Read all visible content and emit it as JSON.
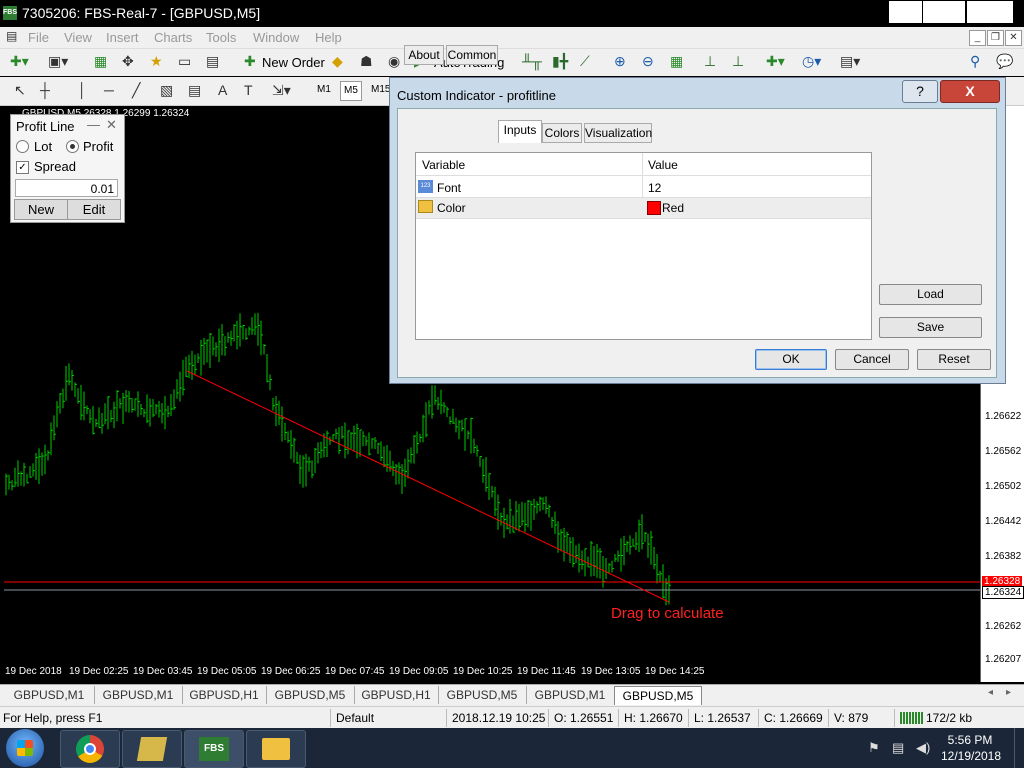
{
  "window": {
    "title": "7305206: FBS-Real-7 - [GBPUSD,M5]",
    "app_badge": "FBS"
  },
  "menu": [
    "File",
    "View",
    "Insert",
    "Charts",
    "Tools",
    "Window",
    "Help"
  ],
  "toolbar": {
    "new_order": "New Order",
    "auto_trading": "AutoTrading",
    "tf_m1": "M1",
    "tf_m5": "M5",
    "tf_m15": "M15"
  },
  "chart": {
    "info_line": "26328 1.26299 1.26324",
    "annotation": "Drag to calculate",
    "price_labels": [
      "97",
      "37",
      "77",
      "17",
      "57",
      "02",
      "42",
      "82",
      "1.26622",
      "1.26562",
      "1.26502",
      "1.26442",
      "1.26382",
      "1.26322",
      "1.26262",
      "1.26207"
    ],
    "current_price_red": "1.26328",
    "current_price": "1.26324",
    "time_labels": [
      "19 Dec 2018",
      "19 Dec 02:25",
      "19 Dec 03:45",
      "19 Dec 05:05",
      "19 Dec 06:25",
      "19 Dec 07:45",
      "19 Dec 09:05",
      "19 Dec 10:25",
      "19 Dec 11:45",
      "19 Dec 13:05",
      "19 Dec 14:25"
    ],
    "line_color": "#ff0000",
    "candle_color": "#00cc00"
  },
  "profit_panel": {
    "title": "Profit Line",
    "lot_label": "Lot",
    "profit_label": "Profit",
    "spread_label": "Spread",
    "value": "0.01",
    "new_label": "New",
    "edit_label": "Edit"
  },
  "dialog": {
    "title": "Custom Indicator - profitline",
    "tabs": [
      "About",
      "Common",
      "Inputs",
      "Colors",
      "Visualization"
    ],
    "active_tab": "Inputs",
    "col_variable": "Variable",
    "col_value": "Value",
    "rows": [
      {
        "icon": "123",
        "variable": "Font",
        "value": "12"
      },
      {
        "variable": "Color",
        "value": "Red",
        "swatch": "#ff0000"
      }
    ],
    "load": "Load",
    "save": "Save",
    "ok": "OK",
    "cancel": "Cancel",
    "reset": "Reset",
    "help_glyph": "?",
    "close_glyph": "X"
  },
  "tabs": [
    "GBPUSD,M1",
    "GBPUSD,M1",
    "GBPUSD,H1",
    "GBPUSD,M5",
    "GBPUSD,H1",
    "GBPUSD,M5",
    "GBPUSD,M1",
    "GBPUSD,M5"
  ],
  "active_tab_index": 7,
  "status": {
    "help": "For Help, press F1",
    "profile": "Default",
    "datetime": "2018.12.19 10:25",
    "open": "O: 1.26551",
    "high": "H: 1.26670",
    "low": "L: 1.26537",
    "close": "C: 1.26669",
    "volume": "V: 879",
    "traffic": "172/2 kb"
  },
  "taskbar": {
    "time": "5:56 PM",
    "date": "12/19/2018",
    "fbs_label": "FBS"
  }
}
